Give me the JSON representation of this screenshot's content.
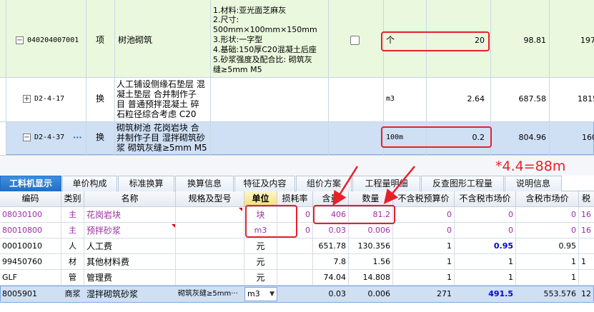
{
  "upper_rows": [
    {
      "code": "040204007001",
      "type": "项",
      "name": "树池砌筑",
      "features": [
        "1.材料:亚光面芝麻灰",
        "2.尺寸:",
        "500mm×100mm×150mm",
        "3.形状:一字型",
        "4.基础:150厚C20混凝土后座",
        "5.砂浆强度及配合比: 砌筑灰",
        "缝≥5mm M5"
      ],
      "unit": "个",
      "quantity": "20",
      "price": "98.81",
      "total": "197"
    },
    {
      "code": "D2-4-17",
      "type": "换",
      "name_lines": [
        "人工铺设侧缘石垫层 混",
        "凝土垫层  合并制作子",
        "目 普通预拌混凝土 碎",
        "石粒径综合考虑 C20"
      ],
      "unit": "m3",
      "quantity": "2.64",
      "price": "687.58",
      "total": "1815"
    },
    {
      "code": "D2-4-37",
      "ellipsis": "···",
      "type": "换",
      "name_lines": [
        "砌筑树池 花岗岩块  合",
        "并制作子目 湿拌砌筑砂",
        "浆 砌筑灰缝≥5mm M5"
      ],
      "unit": "100m",
      "quantity": "0.2",
      "price": "804.96",
      "total": "160"
    }
  ],
  "annotation": "*4.4=88m",
  "tabs": [
    "工料机显示",
    "单价构成",
    "标准换算",
    "换算信息",
    "特征及内容",
    "组价方案",
    "工程量明细",
    "反查图形工程量",
    "说明信息"
  ],
  "lower_headers": [
    "编码",
    "类别",
    "名称",
    "规格及型号",
    "单位",
    "损耗率",
    "含量",
    "数量",
    "不含税预算价",
    "不含税市场价",
    "含税市场价",
    "税"
  ],
  "lower_rows": [
    {
      "code": "08030100",
      "cat": "主",
      "name": "花岗岩块",
      "spec": "",
      "unit": "块",
      "loss": "0",
      "content": "406",
      "qty": "81.2",
      "budget": "0",
      "market": "0",
      "taxmarket": "0",
      "tax": "16"
    },
    {
      "code": "80010800",
      "cat": "主",
      "name": "预拌砂浆",
      "spec": "",
      "unit": "m3",
      "loss": "0",
      "content": "0.03",
      "qty": "0.006",
      "budget": "0",
      "market": "0",
      "taxmarket": "0",
      "tax": "16"
    },
    {
      "code": "00010010",
      "cat": "人",
      "name": "人工费",
      "spec": "",
      "unit": "元",
      "loss": "",
      "content": "651.78",
      "qty": "130.356",
      "budget": "1",
      "market": "0.95",
      "taxmarket": "0.95",
      "tax": ""
    },
    {
      "code": "99450760",
      "cat": "材",
      "name": "其他材料费",
      "spec": "",
      "unit": "元",
      "loss": "",
      "content": "7.8",
      "qty": "1.56",
      "budget": "1",
      "market": "1",
      "taxmarket": "1",
      "tax": "1"
    },
    {
      "code": "GLF",
      "cat": "管",
      "name": "管理费",
      "spec": "",
      "unit": "元",
      "loss": "",
      "content": "74.04",
      "qty": "14.808",
      "budget": "1",
      "market": "1",
      "taxmarket": "1",
      "tax": ""
    },
    {
      "code": "8005901",
      "cat": "商浆",
      "name": "湿拌砌筑砂浆",
      "spec": "砌筑灰缝≥5mm···",
      "unit": "m3",
      "loss": "",
      "content": "0.03",
      "qty": "0.006",
      "budget": "271",
      "market": "491.5",
      "taxmarket": "553.576",
      "tax": "12"
    }
  ],
  "colors": {
    "accent": "#1f6fc7",
    "annotation_red": "#e8202a",
    "row_green": "#eaf8de",
    "row_blue": "#cfe0f5"
  }
}
